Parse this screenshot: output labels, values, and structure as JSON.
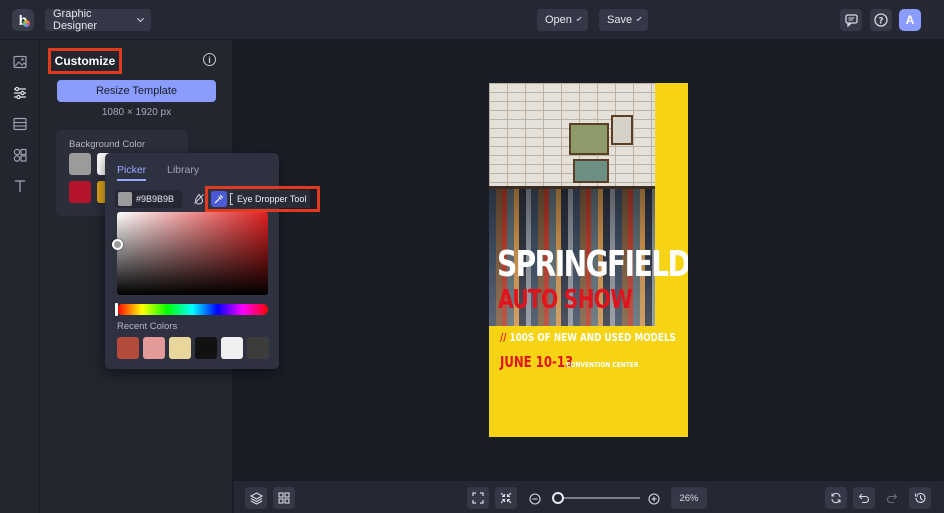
{
  "topbar": {
    "app_mode": "Graphic Designer",
    "open_label": "Open",
    "save_label": "Save",
    "avatar_initial": "A"
  },
  "panel": {
    "title": "Customize",
    "resize_label": "Resize Template",
    "template_size": "1080 × 1920 px",
    "background_color_label": "Background Color",
    "background_swatches": [
      "#9b9b9b",
      "#ffffff",
      "#b5142d",
      "#d9a319"
    ]
  },
  "picker": {
    "tab_picker": "Picker",
    "tab_library": "Library",
    "hex_value": "#9B9B9B",
    "eyedropper_tooltip": "Eye Dropper Tool",
    "recent_label": "Recent Colors",
    "recent_colors": [
      "#b44a3a",
      "#e39a98",
      "#e8d69a",
      "#111111",
      "#efeef0",
      "#3c3d3a"
    ]
  },
  "poster": {
    "title": "SPRINGFIELD",
    "subtitle": "AUTO SHOW",
    "slash": "//",
    "tagline": "100S OF NEW AND USED MODELS",
    "date": "JUNE 10-13",
    "venue": "CONVENTION CENTER",
    "background_color": "#f6d313",
    "accent_color": "#e0141c"
  },
  "bottombar": {
    "zoom_level": "26%",
    "zoom_fraction": 0.0
  },
  "colors": {
    "accent": "#8b9cff",
    "highlight": "#e23a1e"
  }
}
